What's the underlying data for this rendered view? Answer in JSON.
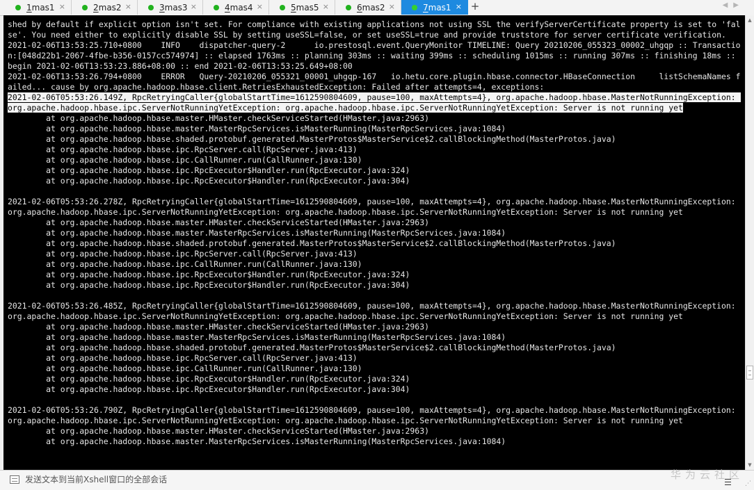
{
  "tabs": [
    {
      "number": "1",
      "name": "mas1",
      "active": false
    },
    {
      "number": "2",
      "name": "mas2",
      "active": false
    },
    {
      "number": "3",
      "name": "mas3",
      "active": false
    },
    {
      "number": "4",
      "name": "mas4",
      "active": false
    },
    {
      "number": "5",
      "name": "mas5",
      "active": false
    },
    {
      "number": "6",
      "name": "mas2",
      "active": false
    },
    {
      "number": "7",
      "name": "mas1",
      "active": true
    }
  ],
  "tab_close_glyph": "×",
  "new_tab_glyph": "+",
  "terminal": {
    "lines": [
      "shed by default if explicit option isn't set. For compliance with existing applications not using SSL the verifyServerCertificate property is set to 'false'. You need either to explicitly disable SSL by setting useSSL=false, or set useSSL=true and provide truststore for server certificate verification.",
      "2021-02-06T13:53:25.710+0800    INFO    dispatcher-query-2      io.prestosql.event.QueryMonitor TIMELINE: Query 20210206_055323_00002_uhgqp :: Transaction:[048d22b1-2067-4fbe-b356-0157cc574974] :: elapsed 1763ms :: planning 303ms :: waiting 399ms :: scheduling 1015ms :: running 307ms :: finishing 18ms :: begin 2021-02-06T13:53:23.886+08:00 :: end 2021-02-06T13:53:25.649+08:00",
      "2021-02-06T13:53:26.794+0800    ERROR   Query-20210206_055321_00001_uhgqp-167   io.hetu.core.plugin.hbase.connector.HBaseConnection     listSchemaNames failed... cause by org.apache.hadoop.hbase.client.RetriesExhaustedException: Failed after attempts=4, exceptions:",
      "2021-02-06T05:53:26.149Z, RpcRetryingCaller{globalStartTime=1612590804609, pause=100, maxAttempts=4}, org.apache.hadoop.hbase.MasterNotRunningException: org.apache.hadoop.hbase.ipc.ServerNotRunningYetException: org.apache.hadoop.hbase.ipc.ServerNotRunningYetException: Server is not running yet",
      "        at org.apache.hadoop.hbase.master.HMaster.checkServiceStarted(HMaster.java:2963)",
      "        at org.apache.hadoop.hbase.master.MasterRpcServices.isMasterRunning(MasterRpcServices.java:1084)",
      "        at org.apache.hadoop.hbase.shaded.protobuf.generated.MasterProtos$MasterService$2.callBlockingMethod(MasterProtos.java)",
      "        at org.apache.hadoop.hbase.ipc.RpcServer.call(RpcServer.java:413)",
      "        at org.apache.hadoop.hbase.ipc.CallRunner.run(CallRunner.java:130)",
      "        at org.apache.hadoop.hbase.ipc.RpcExecutor$Handler.run(RpcExecutor.java:324)",
      "        at org.apache.hadoop.hbase.ipc.RpcExecutor$Handler.run(RpcExecutor.java:304)",
      "",
      "2021-02-06T05:53:26.278Z, RpcRetryingCaller{globalStartTime=1612590804609, pause=100, maxAttempts=4}, org.apache.hadoop.hbase.MasterNotRunningException: org.apache.hadoop.hbase.ipc.ServerNotRunningYetException: org.apache.hadoop.hbase.ipc.ServerNotRunningYetException: Server is not running yet",
      "        at org.apache.hadoop.hbase.master.HMaster.checkServiceStarted(HMaster.java:2963)",
      "        at org.apache.hadoop.hbase.master.MasterRpcServices.isMasterRunning(MasterRpcServices.java:1084)",
      "        at org.apache.hadoop.hbase.shaded.protobuf.generated.MasterProtos$MasterService$2.callBlockingMethod(MasterProtos.java)",
      "        at org.apache.hadoop.hbase.ipc.RpcServer.call(RpcServer.java:413)",
      "        at org.apache.hadoop.hbase.ipc.CallRunner.run(CallRunner.java:130)",
      "        at org.apache.hadoop.hbase.ipc.RpcExecutor$Handler.run(RpcExecutor.java:324)",
      "        at org.apache.hadoop.hbase.ipc.RpcExecutor$Handler.run(RpcExecutor.java:304)",
      "",
      "2021-02-06T05:53:26.485Z, RpcRetryingCaller{globalStartTime=1612590804609, pause=100, maxAttempts=4}, org.apache.hadoop.hbase.MasterNotRunningException: org.apache.hadoop.hbase.ipc.ServerNotRunningYetException: org.apache.hadoop.hbase.ipc.ServerNotRunningYetException: Server is not running yet",
      "        at org.apache.hadoop.hbase.master.HMaster.checkServiceStarted(HMaster.java:2963)",
      "        at org.apache.hadoop.hbase.master.MasterRpcServices.isMasterRunning(MasterRpcServices.java:1084)",
      "        at org.apache.hadoop.hbase.shaded.protobuf.generated.MasterProtos$MasterService$2.callBlockingMethod(MasterProtos.java)",
      "        at org.apache.hadoop.hbase.ipc.RpcServer.call(RpcServer.java:413)",
      "        at org.apache.hadoop.hbase.ipc.CallRunner.run(CallRunner.java:130)",
      "        at org.apache.hadoop.hbase.ipc.RpcExecutor$Handler.run(RpcExecutor.java:324)",
      "        at org.apache.hadoop.hbase.ipc.RpcExecutor$Handler.run(RpcExecutor.java:304)",
      "",
      "2021-02-06T05:53:26.790Z, RpcRetryingCaller{globalStartTime=1612590804609, pause=100, maxAttempts=4}, org.apache.hadoop.hbase.MasterNotRunningException: org.apache.hadoop.hbase.ipc.ServerNotRunningYetException: org.apache.hadoop.hbase.ipc.ServerNotRunningYetException: Server is not running yet",
      "        at org.apache.hadoop.hbase.master.HMaster.checkServiceStarted(HMaster.java:2963)",
      "        at org.apache.hadoop.hbase.master.MasterRpcServices.isMasterRunning(MasterRpcServices.java:1084)"
    ],
    "selected_line_index": 3
  },
  "compose": {
    "placeholder": "发送文本到当前Xshell窗口的全部会话"
  },
  "watermark": "华为云社区",
  "colors": {
    "active_tab": "#1e8ae0",
    "status_dot": "#21b21e",
    "terminal_bg": "#000000",
    "terminal_fg": "#e6e6e6",
    "selection_bg": "#f4f4f4"
  }
}
